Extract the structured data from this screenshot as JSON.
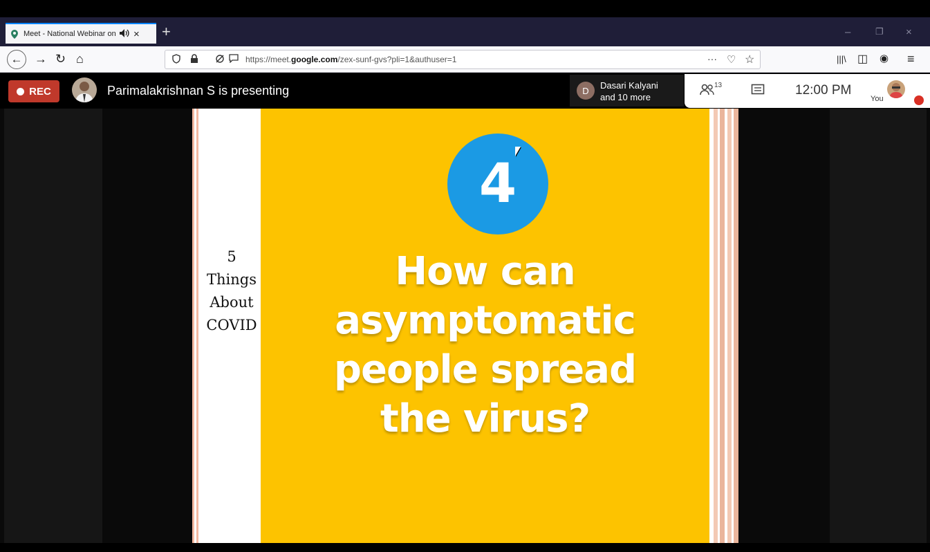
{
  "browser": {
    "tab": {
      "title": "Meet - National Webinar on",
      "sound_icon": "speaker-icon",
      "close_glyph": "×"
    },
    "new_tab_glyph": "+",
    "window_controls": {
      "minimize": "–",
      "restore": "❐",
      "close": "×"
    },
    "nav": {
      "back": "←",
      "forward": "→",
      "reload": "↻",
      "home": "⌂"
    },
    "url": {
      "prefix": "https://meet.",
      "domain": "google.com",
      "path": "/zex-sunf-gvs?pli=1&authuser=1"
    },
    "url_actions": {
      "more": "···",
      "pocket": "♡",
      "star": "☆"
    },
    "toolbar_icons": {
      "library": "|||\\",
      "sidebar": "◫",
      "account": "◉",
      "menu": "≡"
    }
  },
  "meet": {
    "rec_label": "REC",
    "presenting_text": "Parimalakrishnan S is presenting",
    "participant_initial": "D",
    "participant_name": "Dasari Kalyani",
    "participant_more": "and 10 more",
    "people_count": "13",
    "clock": "12:00 PM",
    "you_label": "You"
  },
  "slide": {
    "side_lines": [
      "5",
      "Things",
      "About",
      "COVID"
    ],
    "number": "4",
    "question_lines": [
      "How can",
      "asymptomatic",
      "people spread",
      "the virus?"
    ]
  },
  "colors": {
    "slide_yellow": "#fdc300",
    "badge_blue": "#1b9ae4",
    "rec_red": "#c0392b"
  }
}
